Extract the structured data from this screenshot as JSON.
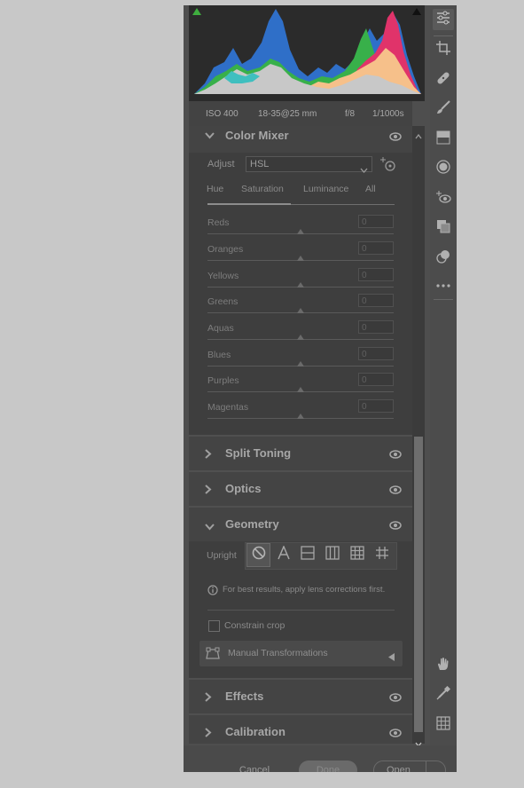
{
  "histogram": {
    "shadow_clip_color": "#3fae3f",
    "highlight_clip_color": "#111111"
  },
  "meta": {
    "iso": "ISO 400",
    "lens": "18-35@25 mm",
    "aperture": "f/8",
    "shutter": "1/1000s"
  },
  "color_mixer": {
    "title": "Color Mixer",
    "adjust_label": "Adjust",
    "adjust_value": "HSL",
    "tabs": [
      "Hue",
      "Saturation",
      "Luminance",
      "All"
    ],
    "rows": [
      {
        "label": "Reds",
        "value": "0"
      },
      {
        "label": "Oranges",
        "value": "0"
      },
      {
        "label": "Yellows",
        "value": "0"
      },
      {
        "label": "Greens",
        "value": "0"
      },
      {
        "label": "Aquas",
        "value": "0"
      },
      {
        "label": "Blues",
        "value": "0"
      },
      {
        "label": "Purples",
        "value": "0"
      },
      {
        "label": "Magentas",
        "value": "0"
      }
    ]
  },
  "sections": {
    "split_toning": "Split Toning",
    "optics": "Optics",
    "geometry": "Geometry",
    "effects": "Effects",
    "calibration": "Calibration"
  },
  "geometry": {
    "upright_label": "Upright",
    "info": "For best results, apply lens corrections first.",
    "constrain_crop": "Constrain crop",
    "manual_transformations": "Manual Transformations"
  },
  "footer": {
    "cancel": "Cancel",
    "done": "Done",
    "open": "Open"
  },
  "toolbar": {
    "icons": [
      "sliders-icon",
      "crop-icon",
      "healing-icon",
      "brush-icon",
      "gradient-icon",
      "radial-filter-icon",
      "red-eye-icon",
      "snapshots-icon",
      "presets-icon",
      "more-icon",
      "hand-icon",
      "eyedropper-icon",
      "grid-icon"
    ]
  }
}
